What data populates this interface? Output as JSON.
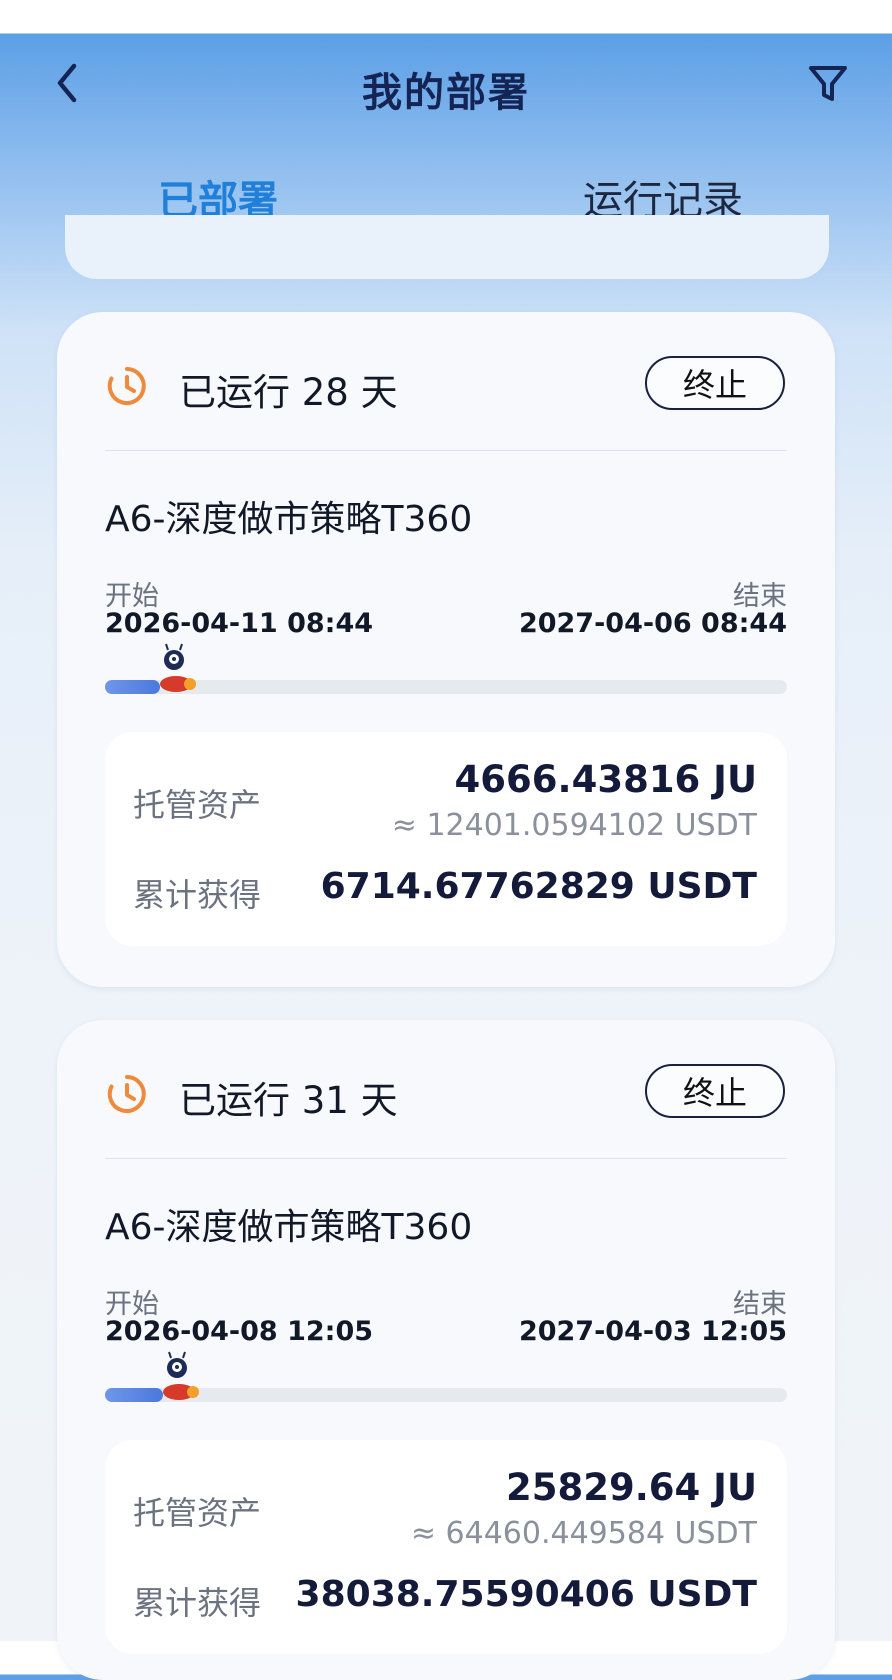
{
  "header": {
    "title": "我的部署"
  },
  "tabs": [
    {
      "label": "已部署",
      "active": true
    },
    {
      "label": "运行记录",
      "active": false
    }
  ],
  "deployments": [
    {
      "running_text": "已运行 28 天",
      "stop_label": "终止",
      "strategy": "A6-深度做市策略T360",
      "start_label": "开始",
      "start_date": "2026-04-11 08:44",
      "end_label": "结束",
      "end_date": "2027-04-06 08:44",
      "progress": 0.08,
      "custody_label": "托管资产",
      "custody_value": "4666.43816 JU",
      "custody_approx": "≈ 12401.0594102 USDT",
      "earned_label": "累计获得",
      "earned_value": "6714.67762829 USDT"
    },
    {
      "running_text": "已运行 31 天",
      "stop_label": "终止",
      "strategy": "A6-深度做市策略T360",
      "start_label": "开始",
      "start_date": "2026-04-08 12:05",
      "end_label": "结束",
      "end_date": "2027-04-03 12:05",
      "progress": 0.085,
      "custody_label": "托管资产",
      "custody_value": "25829.64 JU",
      "custody_approx": "≈ 64460.449584 USDT",
      "earned_label": "累计获得",
      "earned_value": "38038.75590406 USDT"
    }
  ],
  "colors": {
    "accent": "#1f7fd9",
    "title": "#142454",
    "clock": "#ef8a3c",
    "progress": "#4a78dd"
  },
  "icons": {
    "back": "chevron-left-icon",
    "filter": "filter-icon",
    "clock": "clock-icon",
    "mascot": "mascot-icon"
  }
}
